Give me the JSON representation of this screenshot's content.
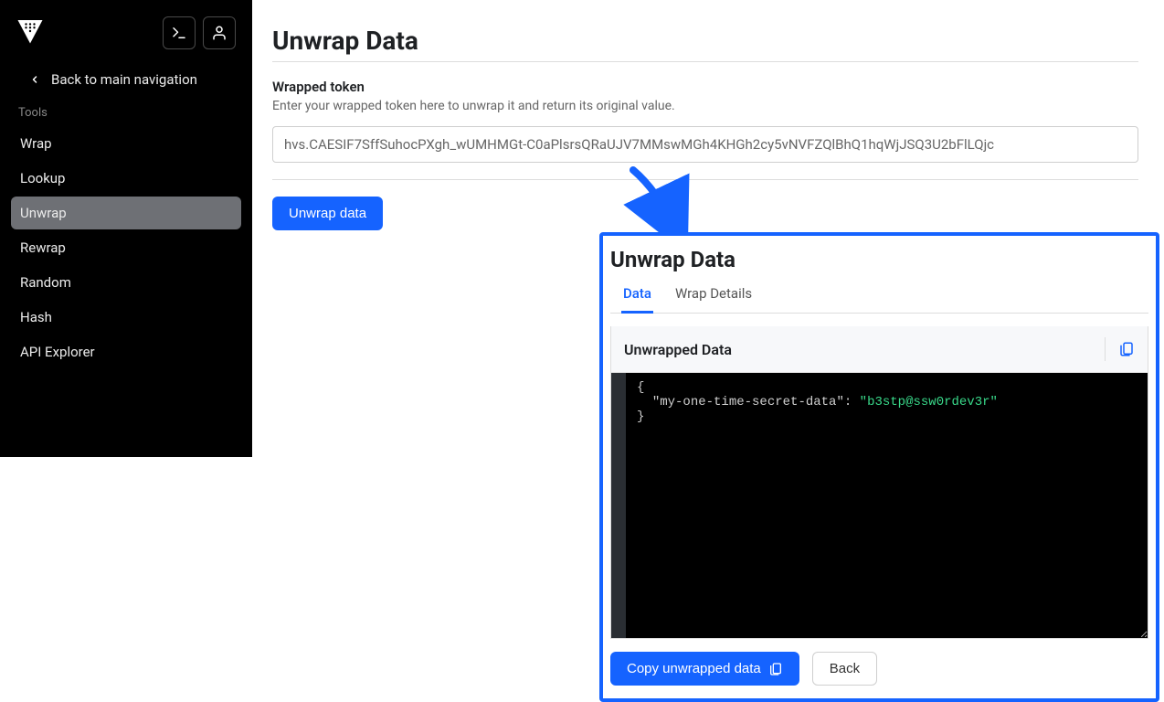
{
  "sidebar": {
    "back_label": "Back to main navigation",
    "tools_label": "Tools",
    "items": [
      {
        "label": "Wrap"
      },
      {
        "label": "Lookup"
      },
      {
        "label": "Unwrap"
      },
      {
        "label": "Rewrap"
      },
      {
        "label": "Random"
      },
      {
        "label": "Hash"
      },
      {
        "label": "API Explorer"
      }
    ],
    "active_index": 2
  },
  "main": {
    "title": "Unwrap Data",
    "form": {
      "label": "Wrapped token",
      "hint": "Enter your wrapped token here to unwrap it and return its original value.",
      "value": "hvs.CAESIF7SffSuhocPXgh_wUMHMGt-C0aPlsrsQRaUJV7MMswMGh4KHGh2cy5vNVFZQlBhQ1hqWjJSQ3U2bFlLQjc"
    },
    "action_label": "Unwrap data"
  },
  "result": {
    "title": "Unwrap Data",
    "tabs": [
      {
        "label": "Data"
      },
      {
        "label": "Wrap Details"
      }
    ],
    "active_tab": 0,
    "panel_header": "Unwrapped Data",
    "json_key": "my-one-time-secret-data",
    "json_value": "b3stp@ssw0rdev3r",
    "copy_label": "Copy unwrapped data",
    "back_label": "Back"
  }
}
